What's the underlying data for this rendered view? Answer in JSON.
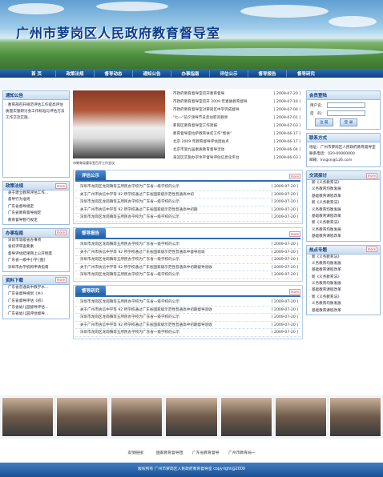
{
  "header": {
    "title": "广州市萝岗区人民政府教育督导室"
  },
  "nav": [
    "首 页",
    "政策法规",
    "督导动态",
    "通知公告",
    "办事指南",
    "评估公示",
    "督导报告",
    "督导研究"
  ],
  "notice": {
    "title": "通知公告",
    "text": "· 教育部召开规范评估工作提高评估质量实施研讨会工作标准与评估方法工作交流实施..."
  },
  "policy": {
    "title": "政策法规",
    "more": "more",
    "items": [
      "关于建立教育评估工作...",
      "督导行为准则",
      "广东省督导规定",
      "广东省教育督导规定",
      "教育督导暂行规定"
    ]
  },
  "guide": {
    "title": "办事指南",
    "more": "more",
    "items": [
      "深圳市等级省办事项",
      "省初评审查要素",
      "督导评估结果网上公开制度",
      "广东省一级中小学 [图]",
      "深圳市办学机构申请指南"
    ]
  },
  "research": {
    "title": "资料下载",
    "more": "more",
    "items": [
      "广东省普通高中教学水...",
      "广东省督导规划《乡》",
      "广东省督导评估《初》",
      "广东省幼儿园督导评估...",
      "广东省幼儿园评估督导..."
    ]
  },
  "photo": {
    "caption": "市教育局督导室召开工作会议"
  },
  "topnews": [
    {
      "t": "市政府教育督导室召开教育督导",
      "d": "[ 2009-07-20 ]"
    },
    {
      "t": "市政府教育督导室召开 2009 年素质教育督导",
      "d": "[ 2009-07-16 ]"
    },
    {
      "t": "市政府教育督导室对萝岗区中学完成督导",
      "d": "[ 2009-07-06 ]"
    },
    {
      "t": "\"七一\"前夕领导节日走访慰问教师",
      "d": "[ 2009-07-01 ]"
    },
    {
      "t": "萝岗区教育督导室工作简报",
      "d": "[ 2009-07-03 ]"
    },
    {
      "t": "教育督导室拉萨教育扶贫工作\"帮扶\"",
      "d": "[ 2009-06-17 ]"
    },
    {
      "t": "北京 2009 年教育督导评估团站点",
      "d": "[ 2009-06-17 ]"
    },
    {
      "t": "北京市第九届素质教育督导活动",
      "d": "[ 2009-06-04 ]"
    },
    {
      "t": "海淀区实施办学水平督导评估信息化平台",
      "d": "[ 2009-06-03 ]"
    }
  ],
  "sections": [
    {
      "title": "评估公示",
      "more": "more",
      "rows": [
        {
          "t": "深圳市龙岗区龙岗镇等五所民办学校为广东省一级学校的公示",
          "d": "[ 2009-07-20 ]"
        },
        {
          "t": "关于广州市执信中学等 92 所学校通过广东省国家级示范性普通高中初",
          "d": "[ 2009-07-20 ]"
        },
        {
          "t": "深圳市龙岗区龙岗镇等五所民办学校为广东省一级学校的公示",
          "d": "[ 2009-07-20 ]"
        },
        {
          "t": "关于广州市执信中学等 92 所学校通过广东省国家级示范性普通高中初期",
          "d": "[ 2009-07-20 ]"
        },
        {
          "t": "深圳市龙岗区龙岗镇等五所民办学校为广东省一级学校的公示",
          "d": "[ 2009-07-20 ]"
        }
      ]
    },
    {
      "title": "督导报告",
      "more": "more",
      "rows": [
        {
          "t": "深圳市龙岗区龙岗镇等五所民办学校为广东省一级学校的公示",
          "d": "[ 2009-07-20 ]"
        },
        {
          "t": "关于广州市执信中学等 92 所学校通过广东省国家级示范性普通高中督导验收",
          "d": "[ 2009-07-20 ]"
        },
        {
          "t": "深圳市龙岗区龙岗镇等五所民办学校为广东省一级学校的公示",
          "d": "[ 2009-07-20 ]"
        },
        {
          "t": "关于广州市执信中学等 92 所学校通过广东省国家级示范性普通高中初期督导验收",
          "d": "[ 2009-07-20 ]"
        },
        {
          "t": "深圳市龙岗区龙岗镇等五所民办学校为广东省一级学校的公示",
          "d": "[ 2009-07-20 ]"
        }
      ]
    },
    {
      "title": "督导研究",
      "more": "more",
      "rows": [
        {
          "t": "深圳市龙岗区龙岗镇等五所民办学校为广东省一级学校的公示",
          "d": "[ 2009-07-20 ]"
        },
        {
          "t": "关于广州市执信中学等 92 所学校通过广东省国家级示范性普通高中初期督导验收",
          "d": "[ 2009-07-20 ]"
        },
        {
          "t": "深圳市龙岗区龙岗镇等五所民办学校为广东省一级学校的公示",
          "d": "[ 2009-07-20 ]"
        },
        {
          "t": "关于广州市执信中学等 92 所学校通过广东省国家级示范性普通高中初期督导验收",
          "d": "[ 2009-07-20 ]"
        },
        {
          "t": "深圳市龙岗区龙岗镇等五所民办学校为广东省一级学校的公示",
          "d": "[ 2009-07-20 ]"
        }
      ]
    }
  ],
  "login": {
    "title": "会员登陆",
    "user_label": "用户名：",
    "pass_label": "密　码：",
    "login": "注 册",
    "register": "登 录"
  },
  "contact": {
    "title": "联系方式",
    "lines": [
      "地址：广州市萝岗区人民政府教育督导室",
      "联系电话：020-00000000",
      "邮箱：lnsgsn@126.com"
    ]
  },
  "exchange": {
    "title": "交流探讨",
    "more": "more",
    "items": [
      "新《义务教育法》",
      "义务教育均衡发展",
      "基础教育课程改革",
      "新《义务教育法》",
      "义务教育均衡发展",
      "基础教育课程改革",
      "新《义务教育法》",
      "义务教育均衡发展",
      "基础教育课程改革"
    ]
  },
  "hot": {
    "title": "热点专题",
    "more": "more",
    "items": [
      "新《义务教育法》",
      "义务教育均衡发展",
      "基础教育课程改革",
      "新《义务教育法》",
      "义务教育均衡发展",
      "基础教育课程改革",
      "新《义务教育法》",
      "义务教育均衡发展",
      "基础教育课程改革"
    ]
  },
  "links": {
    "label": "友情链接：",
    "items": [
      "国家教育督导团",
      "广东省教育督导",
      "广州市教育局一"
    ]
  },
  "footer": {
    "text": "版权所有 广州市萝岗区人民政府教育督导室 copyright@2009"
  }
}
